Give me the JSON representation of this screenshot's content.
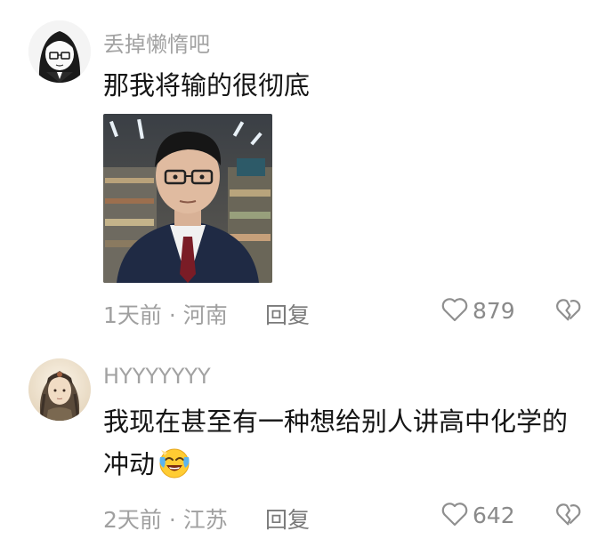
{
  "comments": [
    {
      "username": "丢掉懒惰吧",
      "text": "那我将输的很彻底",
      "time": "1天前",
      "location": "河南",
      "reply_label": "回复",
      "likes": "879",
      "avatar_icon": "anime-girl-avatar",
      "attachment_icon": "photo-man-in-supermarket"
    },
    {
      "username": "HYYYYYYY",
      "text": "我现在甚至有一种想给别人讲高中化学的冲动",
      "emoji": "laughing-crying-face",
      "time": "2天前",
      "location": "江苏",
      "reply_label": "回复",
      "likes": "642",
      "avatar_icon": "anime-character-avatar"
    }
  ],
  "separator": " · ",
  "colors": {
    "username": "#a2a2a2",
    "text": "#151515",
    "meta": "#a0a0a0"
  }
}
